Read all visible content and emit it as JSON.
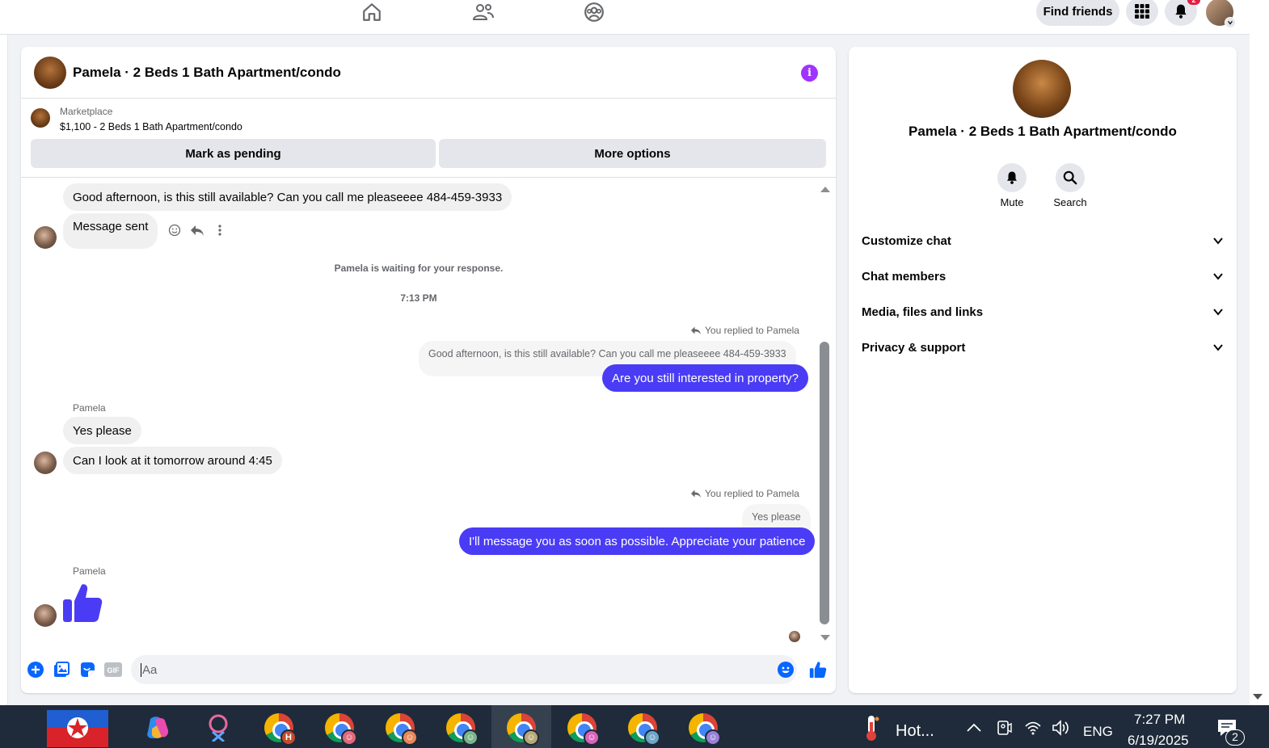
{
  "topbar": {
    "find_friends": "Find friends",
    "notification_count": "2",
    "nav_icons": [
      "home-icon",
      "friends-icon",
      "groups-icon"
    ]
  },
  "chat": {
    "title": "Pamela · 2 Beds 1 Bath Apartment/condo",
    "marketplace_label": "Marketplace",
    "listing": "$1,100 - 2 Beds 1 Bath Apartment/condo",
    "mark_pending": "Mark as pending",
    "more_options": "More options",
    "messages": {
      "m1": "Good afternoon, is this still available?  Can you call me pleaseeee  484-459-3933",
      "m2": "Message sent",
      "waiting": "Pamela is waiting for your response.",
      "time": "7:13 PM",
      "replied1": "You replied to Pamela",
      "quote1": "Good afternoon, is this still available?  Can you call me pleaseeee  484-459-3933",
      "out1": "Are you still interested in property?",
      "sender1": "Pamela",
      "in1": "Yes please",
      "in2": "Can I look at it tomorrow around 4:45",
      "replied2": "You replied to Pamela",
      "quote2": "Yes please",
      "out2": "I'll message you as soon as possible. Appreciate your patience",
      "sender2": "Pamela"
    },
    "composer_placeholder": "Aa"
  },
  "info": {
    "title": "Pamela · 2 Beds 1 Bath Apartment/condo",
    "mute": "Mute",
    "search": "Search",
    "sections": [
      "Customize chat",
      "Chat members",
      "Media, files and links",
      "Privacy & support"
    ]
  },
  "taskbar": {
    "weather": "Hot...",
    "lang": "ENG",
    "time": "7:27 PM",
    "date": "6/19/2025",
    "notif_count": "2"
  },
  "colors": {
    "accent": "#4a3cf5",
    "info_purple": "#a033ff",
    "fb_blue": "#0866ff"
  }
}
